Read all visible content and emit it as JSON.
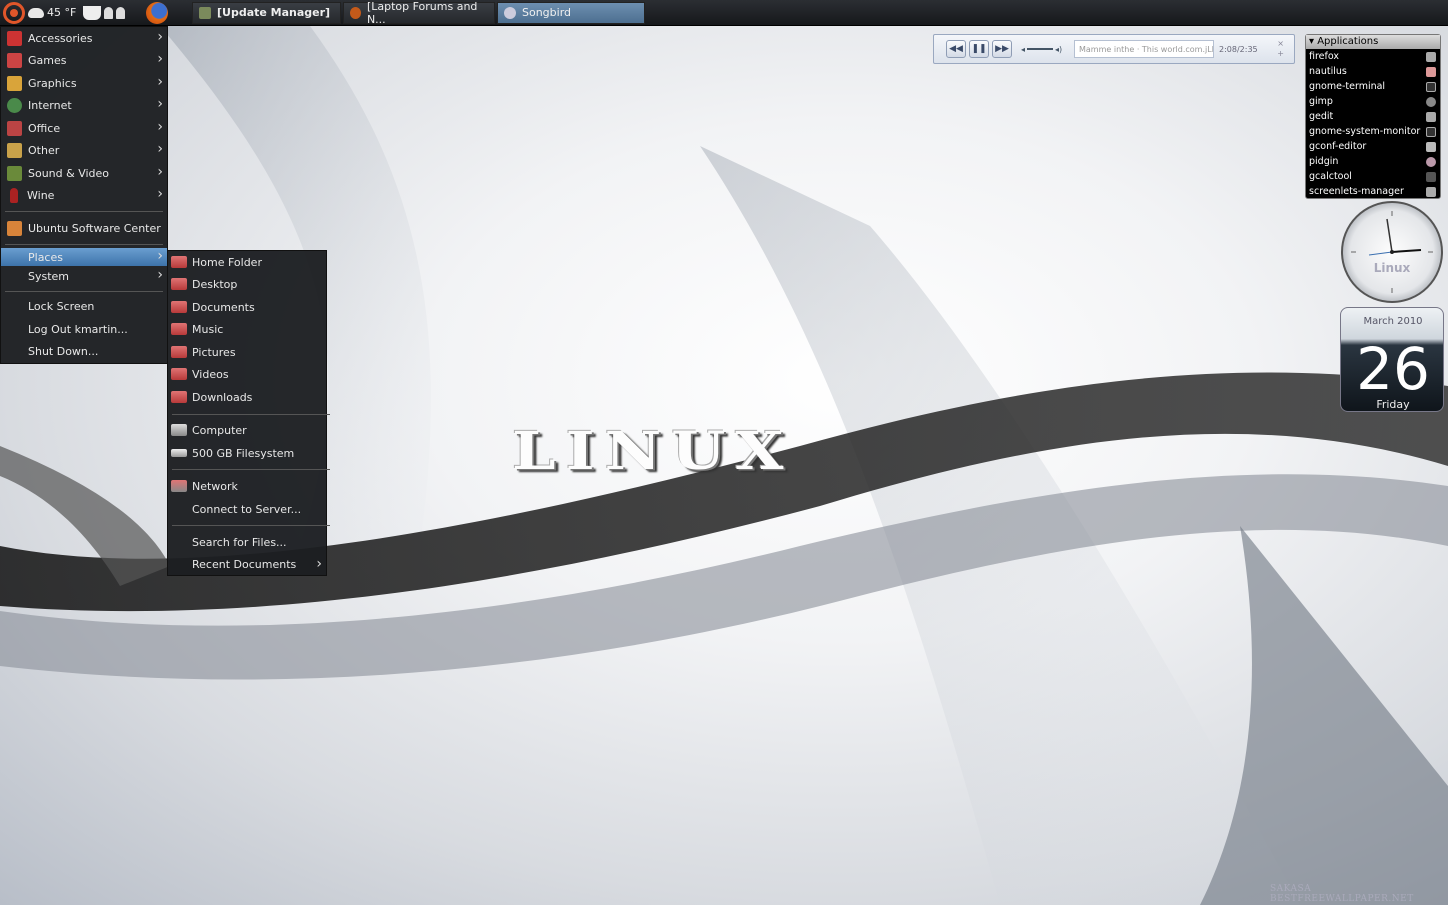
{
  "panel": {
    "temperature": "45 °F",
    "tasks": [
      {
        "label": "[Update Manager]"
      },
      {
        "label": "[Laptop Forums and N..."
      },
      {
        "label": "Songbird"
      }
    ]
  },
  "main_menu": {
    "items": [
      {
        "label": "Accessories",
        "icon": "accessories-icon"
      },
      {
        "label": "Games",
        "icon": "games-icon"
      },
      {
        "label": "Graphics",
        "icon": "graphics-icon"
      },
      {
        "label": "Internet",
        "icon": "internet-icon"
      },
      {
        "label": "Office",
        "icon": "office-icon"
      },
      {
        "label": "Other",
        "icon": "other-icon"
      },
      {
        "label": "Sound & Video",
        "icon": "sound-video-icon"
      },
      {
        "label": "Wine",
        "icon": "wine-icon"
      }
    ],
    "software_center": "Ubuntu Software Center",
    "places": "Places",
    "system": "System",
    "lock_screen": "Lock Screen",
    "log_out": "Log Out kmartin...",
    "shut_down": "Shut Down..."
  },
  "places_menu": {
    "home": "Home Folder",
    "desktop": "Desktop",
    "documents": "Documents",
    "music": "Music",
    "pictures": "Pictures",
    "videos": "Videos",
    "downloads": "Downloads",
    "computer": "Computer",
    "filesystem": "500 GB Filesystem",
    "network": "Network",
    "connect": "Connect to Server...",
    "search": "Search for Files...",
    "recent": "Recent Documents"
  },
  "player": {
    "track": "Mamme inthe · This world.com.jLB",
    "time": "2:08/2:35"
  },
  "apps_widget": {
    "title": "Applications",
    "items": [
      "firefox",
      "nautilus",
      "gnome-terminal",
      "gimp",
      "gedit",
      "gnome-system-monitor",
      "gconf-editor",
      "pidgin",
      "gcalctool",
      "screenlets-manager"
    ]
  },
  "clock": {
    "label": "Linux"
  },
  "calendar": {
    "month": "March 2010",
    "day": "26",
    "weekday": "Friday"
  },
  "wallpaper": {
    "logo": "LINUX",
    "credit": "SAKASA BESTFREEWALLPAPER.NET"
  }
}
